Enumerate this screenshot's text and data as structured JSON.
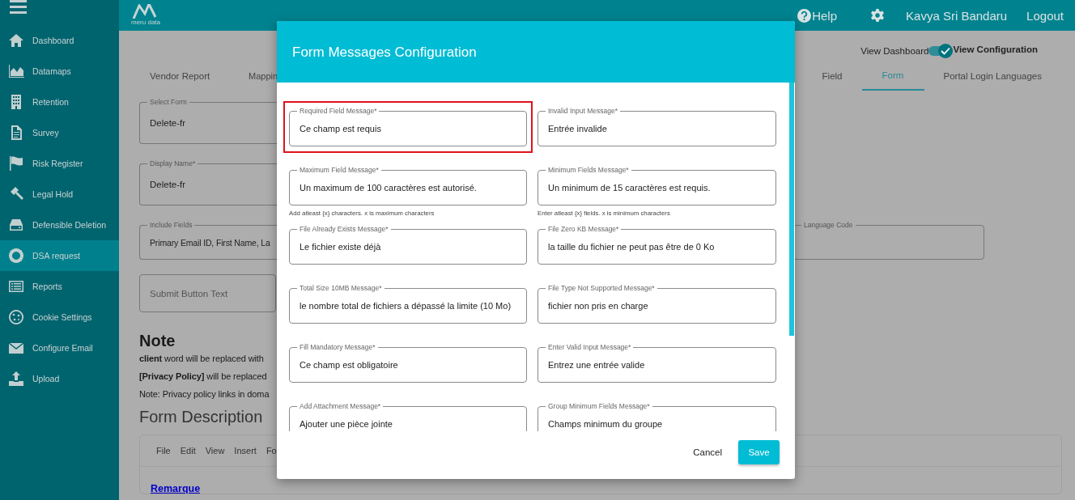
{
  "sidebar": {
    "items": [
      {
        "label": "Dashboard",
        "selected": false
      },
      {
        "label": "Datamaps",
        "selected": false
      },
      {
        "label": "Retention",
        "selected": false
      },
      {
        "label": "Survey",
        "selected": false
      },
      {
        "label": "Risk Register",
        "selected": false
      },
      {
        "label": "Legal Hold",
        "selected": false
      },
      {
        "label": "Defensible Deletion",
        "selected": false
      },
      {
        "label": "DSA request",
        "selected": true
      },
      {
        "label": "Reports",
        "selected": false
      },
      {
        "label": "Cookie Settings",
        "selected": false
      },
      {
        "label": "Configure Email",
        "selected": false
      },
      {
        "label": "Upload",
        "selected": false
      }
    ]
  },
  "header": {
    "logo_text": "meru data",
    "help": "Help",
    "user": "Kavya Sri Bandaru",
    "logout": "Logout"
  },
  "view_toggle": {
    "left_label": "View Dashboard",
    "right_label": "View Configuration",
    "on": true
  },
  "tabs_left": [
    {
      "label": "Vendor Report",
      "selected": false
    },
    {
      "label": "Mappin",
      "selected": false
    }
  ],
  "tabs_right": [
    {
      "label": "Field",
      "selected": false
    },
    {
      "label": "Form",
      "selected": true
    },
    {
      "label": "Portal Login Languages",
      "selected": false
    }
  ],
  "form": {
    "fields": [
      {
        "label": "Select Form",
        "value": "Delete-fr"
      },
      {
        "label": "Display Name*",
        "value": "Delete-fr"
      },
      {
        "label": "Include Fields",
        "value": "Primary Email ID, First Name, La"
      }
    ],
    "language_code": {
      "label": "Language Code"
    },
    "submit_button_text": {
      "placeholder": "Submit Button Text"
    }
  },
  "note": {
    "title": "Note",
    "lines": [
      "**client** word will be replaced with",
      "**[Privacy Policy]** will be replaced",
      "Note: Privacy policy links in doma"
    ]
  },
  "form_description": {
    "title": "Form Description",
    "menu": [
      "File",
      "Edit",
      "View",
      "Insert",
      "Fo"
    ],
    "link": "Remarque"
  },
  "dialog": {
    "title": "Form Messages Configuration",
    "fields": [
      {
        "label": "Required Field Message*",
        "value": "Ce champ est requis",
        "highlighted": true
      },
      {
        "label": "Invalid Input Message*",
        "value": "Entrée invalide",
        "highlighted": false
      },
      {
        "label": "Maximum Field Message*",
        "value": "Un maximum de 100 caractères est autorisé.",
        "hint": "Add atleast {x} characters. x is maximum characters",
        "highlighted": false
      },
      {
        "label": "Minimum Fields Message*",
        "value": "Un minimum de 15 caractères est requis.",
        "hint": "Enter atleast {x} fields. x is minimum characters",
        "highlighted": false
      },
      {
        "label": "File Already Exists Message*",
        "value": "Le fichier existe déjà",
        "highlighted": false
      },
      {
        "label": "File Zero KB Message*",
        "value": "la taille du fichier ne peut pas être de 0 Ko",
        "highlighted": false
      },
      {
        "label": "Total Size 10MB Message*",
        "value": "le nombre total de fichiers a dépassé la limite (10 Mo)",
        "highlighted": false
      },
      {
        "label": "File Type Not Supported Message*",
        "value": "fichier non pris en charge",
        "highlighted": false
      },
      {
        "label": "Fill Mandatory Message*",
        "value": "Ce champ est obligatoire",
        "highlighted": false
      },
      {
        "label": "Enter Valid Input Message*",
        "value": "Entrez une entrée valide",
        "highlighted": false
      },
      {
        "label": "Add Attachment Message*",
        "value": "Ajouter une pièce jointe",
        "highlighted": false
      },
      {
        "label": "Group Minimum Fields Message*",
        "value": "Champs minimum du groupe",
        "highlighted": false
      }
    ],
    "buttons": {
      "cancel": "Cancel",
      "save": "Save"
    }
  }
}
